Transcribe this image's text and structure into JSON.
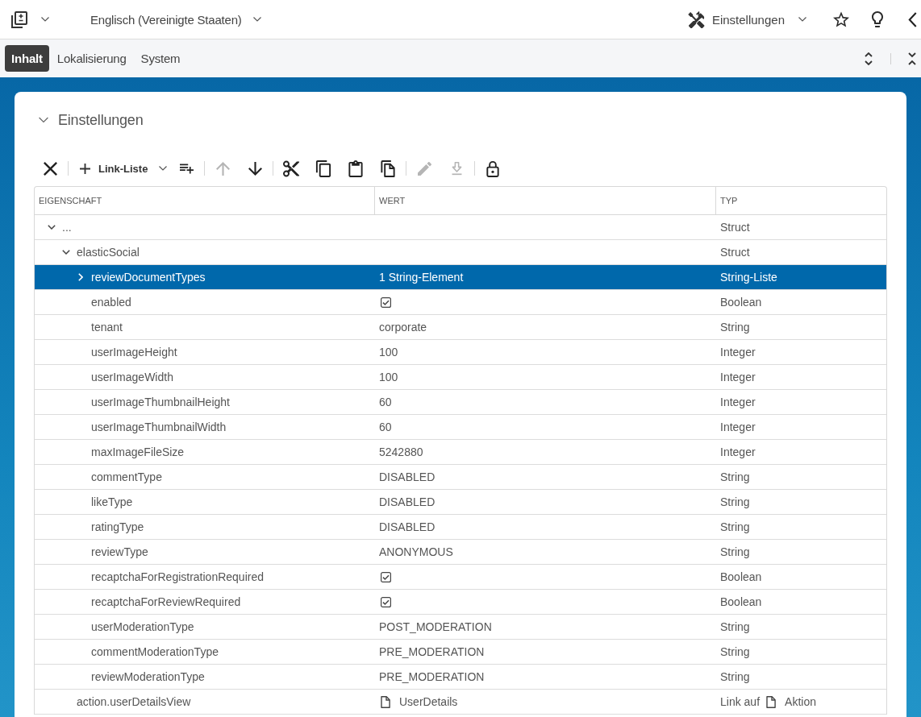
{
  "top_bar": {
    "locale": "Englisch (Vereinigte Staaten)",
    "view": "Einstellungen"
  },
  "tabs": [
    {
      "label": "Inhalt",
      "selected": true
    },
    {
      "label": "Lokalisierung",
      "selected": false
    },
    {
      "label": "System",
      "selected": false
    }
  ],
  "panel": {
    "title": "Einstellungen",
    "expanded": true
  },
  "toolbar": [
    [
      {
        "kind": "icon",
        "disabled": false
      }
    ],
    [
      {
        "kind": "menu",
        "label": "Link-Liste",
        "disabled": false
      },
      {
        "kind": "icon",
        "disabled": false
      }
    ],
    [
      {
        "kind": "icon",
        "disabled": true
      },
      {
        "kind": "icon",
        "disabled": false
      }
    ],
    [
      {
        "kind": "icon",
        "disabled": false
      },
      {
        "kind": "icon",
        "disabled": false
      },
      {
        "kind": "icon",
        "disabled": false
      },
      {
        "kind": "icon",
        "disabled": false
      }
    ],
    [
      {
        "kind": "icon",
        "disabled": true
      },
      {
        "kind": "icon",
        "disabled": true
      }
    ],
    [
      {
        "kind": "icon",
        "disabled": false
      }
    ]
  ],
  "table": {
    "columns": [
      "EIGENSCHAFT",
      "WERT",
      "TYP"
    ],
    "rows": [
      {
        "property": "...",
        "expanded": true,
        "selected": false,
        "type": "Struct",
        "children": [
          {
            "property": "elasticSocial",
            "expanded": true,
            "selected": false,
            "type": "Struct",
            "children": [
              {
                "property": "reviewDocumentTypes",
                "expanded": false,
                "selected": true,
                "value": {
                  "kind": "text",
                  "text": "1 String-Element"
                },
                "type": "String-Liste"
              },
              {
                "property": "enabled",
                "selected": false,
                "value": {
                  "kind": "checkbox",
                  "checked": true
                },
                "type": "Boolean"
              },
              {
                "property": "tenant",
                "selected": false,
                "value": {
                  "kind": "text",
                  "text": "corporate"
                },
                "type": "String"
              },
              {
                "property": "userImageHeight",
                "selected": false,
                "value": {
                  "kind": "text",
                  "text": "100"
                },
                "type": "Integer"
              },
              {
                "property": "userImageWidth",
                "selected": false,
                "value": {
                  "kind": "text",
                  "text": "100"
                },
                "type": "Integer"
              },
              {
                "property": "userImageThumbnailHeight",
                "selected": false,
                "value": {
                  "kind": "text",
                  "text": "60"
                },
                "type": "Integer"
              },
              {
                "property": "userImageThumbnailWidth",
                "selected": false,
                "value": {
                  "kind": "text",
                  "text": "60"
                },
                "type": "Integer"
              },
              {
                "property": "maxImageFileSize",
                "selected": false,
                "value": {
                  "kind": "text",
                  "text": "5242880"
                },
                "type": "Integer"
              },
              {
                "property": "commentType",
                "selected": false,
                "value": {
                  "kind": "text",
                  "text": "DISABLED"
                },
                "type": "String"
              },
              {
                "property": "likeType",
                "selected": false,
                "value": {
                  "kind": "text",
                  "text": "DISABLED"
                },
                "type": "String"
              },
              {
                "property": "ratingType",
                "selected": false,
                "value": {
                  "kind": "text",
                  "text": "DISABLED"
                },
                "type": "String"
              },
              {
                "property": "reviewType",
                "selected": false,
                "value": {
                  "kind": "text",
                  "text": "ANONYMOUS"
                },
                "type": "String"
              },
              {
                "property": "recaptchaForRegistrationRequired",
                "selected": false,
                "value": {
                  "kind": "checkbox",
                  "checked": true
                },
                "type": "Boolean"
              },
              {
                "property": "recaptchaForReviewRequired",
                "selected": false,
                "value": {
                  "kind": "checkbox",
                  "checked": true
                },
                "type": "Boolean"
              },
              {
                "property": "userModerationType",
                "selected": false,
                "value": {
                  "kind": "text",
                  "text": "POST_MODERATION"
                },
                "type": "String"
              },
              {
                "property": "commentModerationType",
                "selected": false,
                "value": {
                  "kind": "text",
                  "text": "PRE_MODERATION"
                },
                "type": "String"
              },
              {
                "property": "reviewModerationType",
                "selected": false,
                "value": {
                  "kind": "text",
                  "text": "PRE_MODERATION"
                },
                "type": "String"
              }
            ]
          },
          {
            "property": "action.userDetailsView",
            "selected": false,
            "value": {
              "kind": "document",
              "text": "UserDetails"
            },
            "type": "Link auf",
            "type_target": "Aktion"
          }
        ]
      }
    ]
  }
}
